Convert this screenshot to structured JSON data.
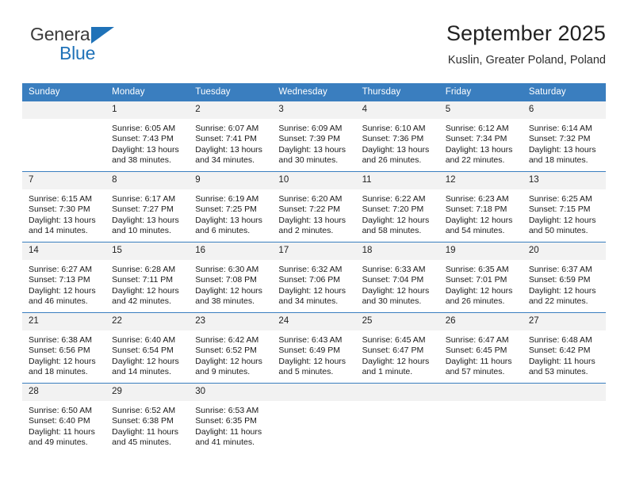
{
  "brand": {
    "name_part1": "General",
    "name_part2": "Blue",
    "flag_icon": "triangle-flag-icon"
  },
  "header": {
    "title": "September 2025",
    "subtitle": "Kuslin, Greater Poland, Poland"
  },
  "colors": {
    "header_blue": "#3a7ebf",
    "brand_blue": "#1f72b8",
    "daynum_bg": "#f2f2f2",
    "text": "#1a1a1a"
  },
  "calendar": {
    "weekday_headers": [
      "Sunday",
      "Monday",
      "Tuesday",
      "Wednesday",
      "Thursday",
      "Friday",
      "Saturday"
    ],
    "weeks": [
      [
        {
          "day": "",
          "blank": true,
          "sunrise": "",
          "sunset": "",
          "daylight_line1": "",
          "daylight_line2": ""
        },
        {
          "day": "1",
          "sunrise": "Sunrise: 6:05 AM",
          "sunset": "Sunset: 7:43 PM",
          "daylight_line1": "Daylight: 13 hours",
          "daylight_line2": "and 38 minutes."
        },
        {
          "day": "2",
          "sunrise": "Sunrise: 6:07 AM",
          "sunset": "Sunset: 7:41 PM",
          "daylight_line1": "Daylight: 13 hours",
          "daylight_line2": "and 34 minutes."
        },
        {
          "day": "3",
          "sunrise": "Sunrise: 6:09 AM",
          "sunset": "Sunset: 7:39 PM",
          "daylight_line1": "Daylight: 13 hours",
          "daylight_line2": "and 30 minutes."
        },
        {
          "day": "4",
          "sunrise": "Sunrise: 6:10 AM",
          "sunset": "Sunset: 7:36 PM",
          "daylight_line1": "Daylight: 13 hours",
          "daylight_line2": "and 26 minutes."
        },
        {
          "day": "5",
          "sunrise": "Sunrise: 6:12 AM",
          "sunset": "Sunset: 7:34 PM",
          "daylight_line1": "Daylight: 13 hours",
          "daylight_line2": "and 22 minutes."
        },
        {
          "day": "6",
          "sunrise": "Sunrise: 6:14 AM",
          "sunset": "Sunset: 7:32 PM",
          "daylight_line1": "Daylight: 13 hours",
          "daylight_line2": "and 18 minutes."
        }
      ],
      [
        {
          "day": "7",
          "sunrise": "Sunrise: 6:15 AM",
          "sunset": "Sunset: 7:30 PM",
          "daylight_line1": "Daylight: 13 hours",
          "daylight_line2": "and 14 minutes."
        },
        {
          "day": "8",
          "sunrise": "Sunrise: 6:17 AM",
          "sunset": "Sunset: 7:27 PM",
          "daylight_line1": "Daylight: 13 hours",
          "daylight_line2": "and 10 minutes."
        },
        {
          "day": "9",
          "sunrise": "Sunrise: 6:19 AM",
          "sunset": "Sunset: 7:25 PM",
          "daylight_line1": "Daylight: 13 hours",
          "daylight_line2": "and 6 minutes."
        },
        {
          "day": "10",
          "sunrise": "Sunrise: 6:20 AM",
          "sunset": "Sunset: 7:22 PM",
          "daylight_line1": "Daylight: 13 hours",
          "daylight_line2": "and 2 minutes."
        },
        {
          "day": "11",
          "sunrise": "Sunrise: 6:22 AM",
          "sunset": "Sunset: 7:20 PM",
          "daylight_line1": "Daylight: 12 hours",
          "daylight_line2": "and 58 minutes."
        },
        {
          "day": "12",
          "sunrise": "Sunrise: 6:23 AM",
          "sunset": "Sunset: 7:18 PM",
          "daylight_line1": "Daylight: 12 hours",
          "daylight_line2": "and 54 minutes."
        },
        {
          "day": "13",
          "sunrise": "Sunrise: 6:25 AM",
          "sunset": "Sunset: 7:15 PM",
          "daylight_line1": "Daylight: 12 hours",
          "daylight_line2": "and 50 minutes."
        }
      ],
      [
        {
          "day": "14",
          "sunrise": "Sunrise: 6:27 AM",
          "sunset": "Sunset: 7:13 PM",
          "daylight_line1": "Daylight: 12 hours",
          "daylight_line2": "and 46 minutes."
        },
        {
          "day": "15",
          "sunrise": "Sunrise: 6:28 AM",
          "sunset": "Sunset: 7:11 PM",
          "daylight_line1": "Daylight: 12 hours",
          "daylight_line2": "and 42 minutes."
        },
        {
          "day": "16",
          "sunrise": "Sunrise: 6:30 AM",
          "sunset": "Sunset: 7:08 PM",
          "daylight_line1": "Daylight: 12 hours",
          "daylight_line2": "and 38 minutes."
        },
        {
          "day": "17",
          "sunrise": "Sunrise: 6:32 AM",
          "sunset": "Sunset: 7:06 PM",
          "daylight_line1": "Daylight: 12 hours",
          "daylight_line2": "and 34 minutes."
        },
        {
          "day": "18",
          "sunrise": "Sunrise: 6:33 AM",
          "sunset": "Sunset: 7:04 PM",
          "daylight_line1": "Daylight: 12 hours",
          "daylight_line2": "and 30 minutes."
        },
        {
          "day": "19",
          "sunrise": "Sunrise: 6:35 AM",
          "sunset": "Sunset: 7:01 PM",
          "daylight_line1": "Daylight: 12 hours",
          "daylight_line2": "and 26 minutes."
        },
        {
          "day": "20",
          "sunrise": "Sunrise: 6:37 AM",
          "sunset": "Sunset: 6:59 PM",
          "daylight_line1": "Daylight: 12 hours",
          "daylight_line2": "and 22 minutes."
        }
      ],
      [
        {
          "day": "21",
          "sunrise": "Sunrise: 6:38 AM",
          "sunset": "Sunset: 6:56 PM",
          "daylight_line1": "Daylight: 12 hours",
          "daylight_line2": "and 18 minutes."
        },
        {
          "day": "22",
          "sunrise": "Sunrise: 6:40 AM",
          "sunset": "Sunset: 6:54 PM",
          "daylight_line1": "Daylight: 12 hours",
          "daylight_line2": "and 14 minutes."
        },
        {
          "day": "23",
          "sunrise": "Sunrise: 6:42 AM",
          "sunset": "Sunset: 6:52 PM",
          "daylight_line1": "Daylight: 12 hours",
          "daylight_line2": "and 9 minutes."
        },
        {
          "day": "24",
          "sunrise": "Sunrise: 6:43 AM",
          "sunset": "Sunset: 6:49 PM",
          "daylight_line1": "Daylight: 12 hours",
          "daylight_line2": "and 5 minutes."
        },
        {
          "day": "25",
          "sunrise": "Sunrise: 6:45 AM",
          "sunset": "Sunset: 6:47 PM",
          "daylight_line1": "Daylight: 12 hours",
          "daylight_line2": "and 1 minute."
        },
        {
          "day": "26",
          "sunrise": "Sunrise: 6:47 AM",
          "sunset": "Sunset: 6:45 PM",
          "daylight_line1": "Daylight: 11 hours",
          "daylight_line2": "and 57 minutes."
        },
        {
          "day": "27",
          "sunrise": "Sunrise: 6:48 AM",
          "sunset": "Sunset: 6:42 PM",
          "daylight_line1": "Daylight: 11 hours",
          "daylight_line2": "and 53 minutes."
        }
      ],
      [
        {
          "day": "28",
          "sunrise": "Sunrise: 6:50 AM",
          "sunset": "Sunset: 6:40 PM",
          "daylight_line1": "Daylight: 11 hours",
          "daylight_line2": "and 49 minutes."
        },
        {
          "day": "29",
          "sunrise": "Sunrise: 6:52 AM",
          "sunset": "Sunset: 6:38 PM",
          "daylight_line1": "Daylight: 11 hours",
          "daylight_line2": "and 45 minutes."
        },
        {
          "day": "30",
          "sunrise": "Sunrise: 6:53 AM",
          "sunset": "Sunset: 6:35 PM",
          "daylight_line1": "Daylight: 11 hours",
          "daylight_line2": "and 41 minutes."
        },
        {
          "day": "",
          "blank": true,
          "sunrise": "",
          "sunset": "",
          "daylight_line1": "",
          "daylight_line2": ""
        },
        {
          "day": "",
          "blank": true,
          "sunrise": "",
          "sunset": "",
          "daylight_line1": "",
          "daylight_line2": ""
        },
        {
          "day": "",
          "blank": true,
          "sunrise": "",
          "sunset": "",
          "daylight_line1": "",
          "daylight_line2": ""
        },
        {
          "day": "",
          "blank": true,
          "sunrise": "",
          "sunset": "",
          "daylight_line1": "",
          "daylight_line2": ""
        }
      ]
    ]
  }
}
